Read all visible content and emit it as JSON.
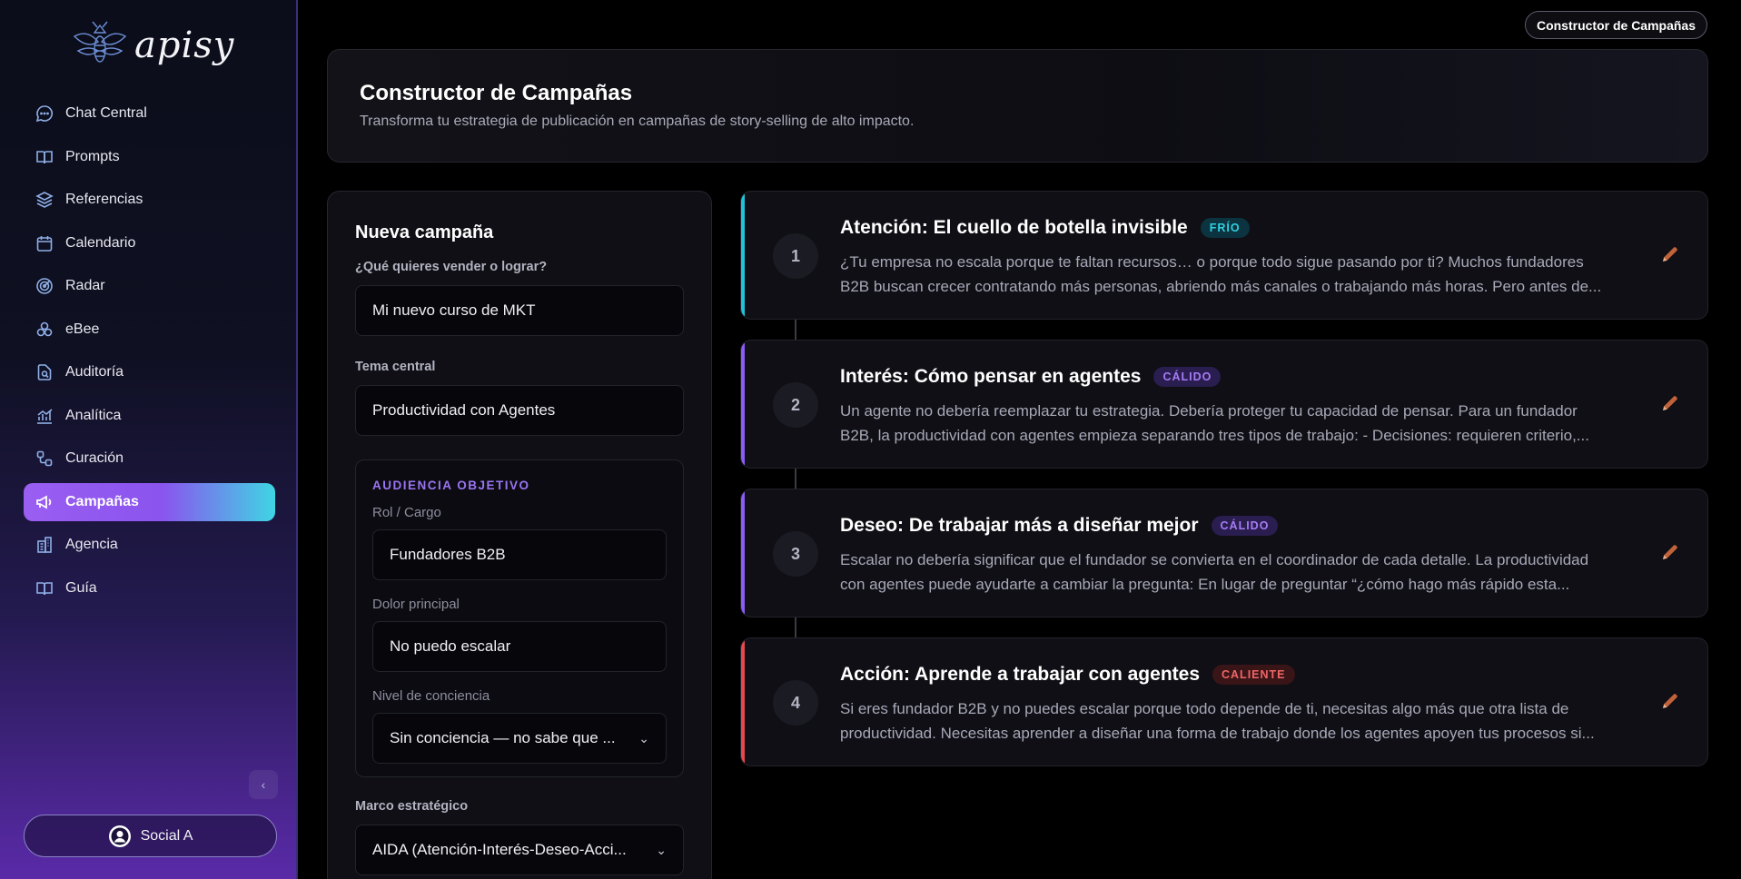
{
  "app": {
    "logo_text": "apisy"
  },
  "sidebar": {
    "items": [
      {
        "label": "Chat Central",
        "icon": "chat-bubble-icon"
      },
      {
        "label": "Prompts",
        "icon": "book-open-icon"
      },
      {
        "label": "Referencias",
        "icon": "layers-icon"
      },
      {
        "label": "Calendario",
        "icon": "calendar-icon"
      },
      {
        "label": "Radar",
        "icon": "radar-icon"
      },
      {
        "label": "eBee",
        "icon": "circles-icon"
      },
      {
        "label": "Auditoría",
        "icon": "file-search-icon"
      },
      {
        "label": "Analítica",
        "icon": "chart-line-icon"
      },
      {
        "label": "Curación",
        "icon": "workflow-icon"
      },
      {
        "label": "Campañas",
        "icon": "megaphone-icon",
        "active": true
      },
      {
        "label": "Agencia",
        "icon": "building-icon"
      },
      {
        "label": "Guía",
        "icon": "book-icon"
      }
    ],
    "social_label": "Social A"
  },
  "top_pill": "Constructor de Campañas",
  "header": {
    "title": "Constructor de Campañas",
    "subtitle": "Transforma tu estrategia de publicación en campañas de story-selling de alto impacto."
  },
  "form": {
    "title": "Nueva campaña",
    "goal_label": "¿Qué quieres vender o lograr?",
    "goal_value": "Mi nuevo curso de MKT",
    "theme_label": "Tema central",
    "theme_value": "Productividad con Agentes",
    "audience": {
      "title": "AUDIENCIA OBJETIVO",
      "role_label": "Rol / Cargo",
      "role_value": "Fundadores B2B",
      "pain_label": "Dolor principal",
      "pain_value": "No puedo escalar",
      "awareness_label": "Nivel de conciencia",
      "awareness_value": "Sin conciencia — no sabe que ..."
    },
    "framework_label": "Marco estratégico",
    "framework_value": "AIDA (Atención-Interés-Deseo-Acci..."
  },
  "cards": [
    {
      "num": "1",
      "title": "Atención: El cuello de botella invisible",
      "badge": "FRÍO",
      "badge_type": "frio",
      "accent": "#22c3d6",
      "line1": "¿Tu empresa no escala porque te faltan recursos… o porque todo sigue pasando por ti? Muchos fundadores",
      "line2": "B2B buscan crecer contratando más personas, abriendo más canales o trabajando más horas. Pero antes de..."
    },
    {
      "num": "2",
      "title": "Interés: Cómo pensar en agentes",
      "badge": "CÁLIDO",
      "badge_type": "calido",
      "accent": "#8b5cf6",
      "line1": "Un agente no debería reemplazar tu estrategia. Debería proteger tu capacidad de pensar. Para un fundador",
      "line2": "B2B, la productividad con agentes empieza separando tres tipos de trabajo: - Decisiones: requieren criterio,..."
    },
    {
      "num": "3",
      "title": "Deseo: De trabajar más a diseñar mejor",
      "badge": "CÁLIDO",
      "badge_type": "calido",
      "accent": "#8b5cf6",
      "line1": "Escalar no debería significar que el fundador se convierta en el coordinador de cada detalle. La productividad",
      "line2": "con agentes puede ayudarte a cambiar la pregunta: En lugar de preguntar “¿cómo hago más rápido esta..."
    },
    {
      "num": "4",
      "title": "Acción: Aprende a trabajar con agentes",
      "badge": "CALIENTE",
      "badge_type": "caliente",
      "accent": "#e5484d",
      "line1": "Si eres fundador B2B y no puedes escalar porque todo depende de ti, necesitas algo más que otra lista de",
      "line2": "productividad. Necesitas aprender a diseñar una forma de trabajo donde los agentes apoyen tus procesos si..."
    }
  ],
  "colors": {
    "accent_purple": "#8b5cf6",
    "accent_cyan": "#3fd5e3",
    "edit_icon": "#c0623a"
  }
}
